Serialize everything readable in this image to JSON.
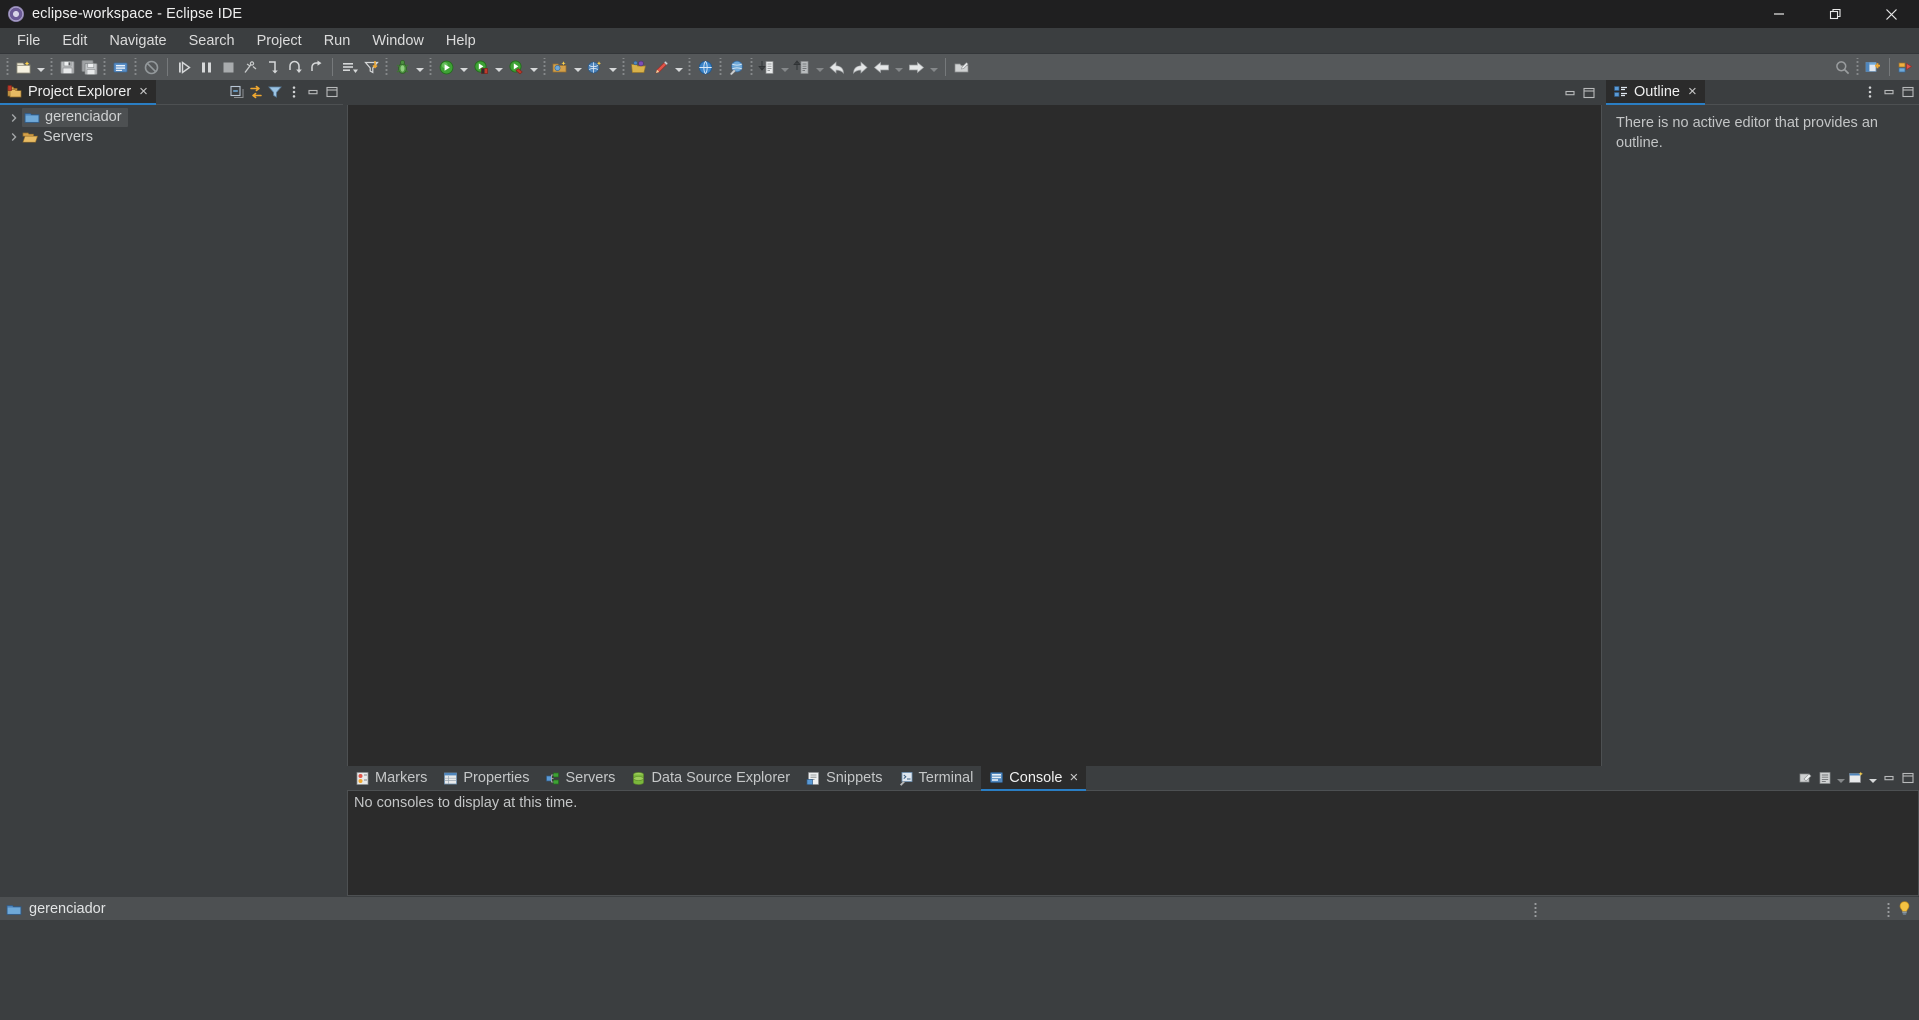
{
  "window": {
    "title": "eclipse-workspace - Eclipse IDE",
    "app_icon": "eclipse-logo-icon",
    "controls": {
      "minimize": "minimize-icon",
      "restore": "restore-icon",
      "close": "close-icon"
    }
  },
  "menubar": {
    "items": [
      {
        "label": "File"
      },
      {
        "label": "Edit"
      },
      {
        "label": "Navigate"
      },
      {
        "label": "Search"
      },
      {
        "label": "Project"
      },
      {
        "label": "Run"
      },
      {
        "label": "Window"
      },
      {
        "label": "Help"
      }
    ]
  },
  "toolbar": {
    "groups": [
      {
        "buttons": [
          {
            "icon": "new-wizard-icon",
            "dropdown": true
          },
          {
            "icon": "save-icon",
            "dropdown": false
          },
          {
            "icon": "save-all-icon",
            "dropdown": false
          }
        ]
      },
      {
        "buttons": [
          {
            "icon": "print-icon",
            "dropdown": false
          }
        ]
      },
      {
        "buttons": [
          {
            "icon": "no-build-icon",
            "dropdown": false
          }
        ]
      },
      {
        "buttons": [
          {
            "icon": "resume-icon",
            "dropdown": false
          },
          {
            "icon": "suspend-icon",
            "dropdown": false
          },
          {
            "icon": "terminate-icon",
            "dropdown": false
          },
          {
            "icon": "disconnect-icon",
            "dropdown": false
          },
          {
            "icon": "step-into-icon",
            "dropdown": false
          },
          {
            "icon": "step-over-icon",
            "dropdown": false
          },
          {
            "icon": "step-return-icon",
            "dropdown": false
          }
        ]
      },
      {
        "buttons": [
          {
            "icon": "drop-to-frame-icon",
            "dropdown": false
          },
          {
            "icon": "use-step-filters-icon",
            "dropdown": false
          }
        ]
      },
      {
        "buttons": [
          {
            "icon": "debug-icon",
            "dropdown": true
          }
        ]
      },
      {
        "buttons": [
          {
            "icon": "run-icon",
            "dropdown": true
          },
          {
            "icon": "coverage-icon",
            "dropdown": true
          },
          {
            "icon": "run-external-tools-icon",
            "dropdown": true
          }
        ]
      },
      {
        "buttons": [
          {
            "icon": "new-java-project-icon",
            "dropdown": true
          },
          {
            "icon": "new-package-icon",
            "dropdown": true
          }
        ]
      },
      {
        "buttons": [
          {
            "icon": "open-type-icon",
            "dropdown": false
          },
          {
            "icon": "search-marker-icon",
            "dropdown": true
          }
        ]
      },
      {
        "buttons": [
          {
            "icon": "open-web-browser-icon",
            "dropdown": false
          }
        ]
      },
      {
        "buttons": [
          {
            "icon": "open-task-icon",
            "dropdown": false
          }
        ]
      },
      {
        "buttons": [
          {
            "icon": "previous-annotation-icon",
            "dropdown": true
          },
          {
            "icon": "next-annotation-icon",
            "dropdown": true
          }
        ]
      },
      {
        "buttons": [
          {
            "icon": "back-arrow-icon",
            "dropdown": false
          },
          {
            "icon": "forward-arrow-icon",
            "dropdown": false
          },
          {
            "icon": "back-history-icon",
            "dropdown": true
          },
          {
            "icon": "forward-history-icon",
            "dropdown": true
          }
        ]
      },
      {
        "buttons": [
          {
            "icon": "new-editor-icon",
            "dropdown": false
          }
        ]
      }
    ],
    "right_buttons": [
      {
        "icon": "quick-access-search-icon"
      },
      {
        "icon": "open-perspective-icon"
      },
      {
        "icon": "java-ee-perspective-icon"
      }
    ]
  },
  "project_explorer": {
    "tab_label": "Project Explorer",
    "tab_icon": "project-explorer-icon",
    "close_icon": "×",
    "tools": [
      {
        "icon": "collapse-all-icon",
        "name": "collapse-all-button"
      },
      {
        "icon": "link-with-editor-icon",
        "name": "link-with-editor-button"
      },
      {
        "icon": "filter-icon",
        "name": "view-filters-button"
      },
      {
        "icon": "view-menu-icon",
        "name": "view-menu-button"
      },
      {
        "icon": "minimize-icon",
        "name": "minimize-view-button"
      },
      {
        "icon": "maximize-icon",
        "name": "maximize-view-button"
      }
    ],
    "tree": [
      {
        "label": "gerenciador",
        "icon": "project-folder-icon",
        "expanded": false,
        "selected": true
      },
      {
        "label": "Servers",
        "icon": "open-folder-icon",
        "expanded": false,
        "selected": false
      }
    ]
  },
  "editor": {
    "tools": [
      {
        "icon": "minimize-icon",
        "name": "minimize-editor-button"
      },
      {
        "icon": "maximize-icon",
        "name": "maximize-editor-button"
      }
    ],
    "content": ""
  },
  "outline": {
    "tab_label": "Outline",
    "tab_icon": "outline-icon",
    "close_icon": "×",
    "tools": [
      {
        "icon": "view-menu-icon",
        "name": "view-menu-button"
      },
      {
        "icon": "minimize-icon",
        "name": "minimize-view-button"
      },
      {
        "icon": "maximize-icon",
        "name": "maximize-view-button"
      }
    ],
    "message": "There is no active editor that provides an outline."
  },
  "bottom_panel": {
    "tabs": [
      {
        "label": "Markers",
        "icon": "markers-icon",
        "active": false,
        "closable": false
      },
      {
        "label": "Properties",
        "icon": "properties-icon",
        "active": false,
        "closable": false
      },
      {
        "label": "Servers",
        "icon": "servers-icon",
        "active": false,
        "closable": false
      },
      {
        "label": "Data Source Explorer",
        "icon": "data-source-explorer-icon",
        "active": false,
        "closable": false
      },
      {
        "label": "Snippets",
        "icon": "snippets-icon",
        "active": false,
        "closable": false
      },
      {
        "label": "Terminal",
        "icon": "terminal-icon",
        "active": false,
        "closable": false
      },
      {
        "label": "Console",
        "icon": "console-icon",
        "active": true,
        "closable": true
      }
    ],
    "close_icon": "×",
    "tools": [
      {
        "icon": "clear-console-icon",
        "name": "clear-console-button"
      },
      {
        "icon": "scroll-lock-icon",
        "name": "scroll-lock-button"
      },
      {
        "icon": "display-selected-console-icon",
        "name": "display-selected-console-button",
        "dropdown": true
      },
      {
        "icon": "open-console-icon",
        "name": "open-console-button",
        "dropdown": true
      },
      {
        "icon": "minimize-icon",
        "name": "minimize-panel-button"
      },
      {
        "icon": "maximize-icon",
        "name": "maximize-panel-button"
      }
    ],
    "console_message": "No consoles to display at this time."
  },
  "statusbar": {
    "selection_icon": "project-folder-icon",
    "selection_label": "gerenciador",
    "tip_icon": "tip-of-the-day-icon"
  },
  "colors": {
    "accent_blue": "#2a7ec4",
    "panel_bg": "#3b3e40",
    "editor_bg": "#2b2b2b",
    "toolbar_bg": "#55585a",
    "titlebar_bg": "#1f1f20",
    "statusbar_bg": "#4d5052",
    "text_primary": "#f0f0f0",
    "text_secondary": "#c3c5c6"
  }
}
